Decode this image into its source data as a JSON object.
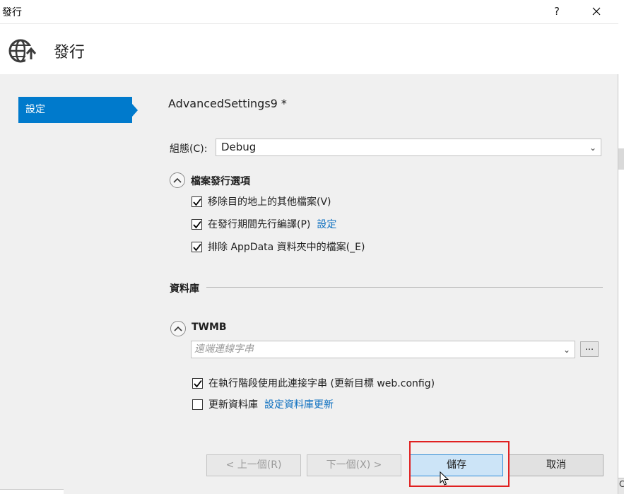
{
  "window": {
    "title": "發行",
    "help_label": "?",
    "header_title": "發行"
  },
  "sidebar": {
    "items": [
      {
        "label": "設定",
        "selected": true
      }
    ]
  },
  "main": {
    "profile_name": "AdvancedSettings9 *",
    "configuration": {
      "label": "組態(C):",
      "value": "Debug"
    },
    "file_publish": {
      "title": "檔案發行選項",
      "options": [
        {
          "label": "移除目的地上的其他檔案(V)",
          "checked": true
        },
        {
          "label": "在發行期間先行編譯(P)",
          "checked": true,
          "link": "設定"
        },
        {
          "label": "排除 AppData 資料夾中的檔案(_E)",
          "checked": true
        }
      ]
    },
    "databases": {
      "title": "資料庫",
      "entry": {
        "name": "TWMB",
        "connection_placeholder": "遠端連線字串",
        "browse_label": "...",
        "use_conn_string": {
          "label": "在執行階段使用此連接字串 (更新目標 web.config)",
          "checked": true
        },
        "update_db": {
          "label": "更新資料庫",
          "checked": false,
          "link": "設定資料庫更新"
        }
      }
    }
  },
  "footer": {
    "prev_label": "< 上一個(R)",
    "next_label": "下一個(X) >",
    "save_label": "儲存",
    "cancel_label": "取消"
  },
  "colors": {
    "accent": "#007acc",
    "link": "#0e70c0",
    "highlight_box": "#e02020"
  },
  "right_edge_glyph": "C)"
}
